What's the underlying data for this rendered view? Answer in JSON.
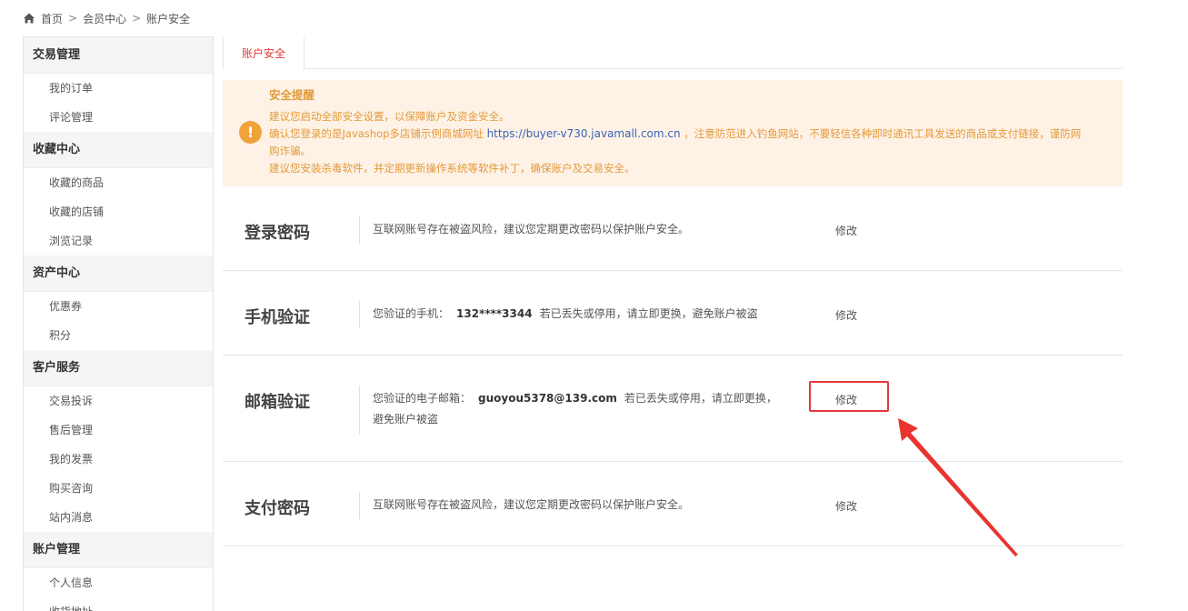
{
  "breadcrumb": {
    "home": "首页",
    "sep": ">",
    "member_center": "会员中心",
    "current": "账户安全"
  },
  "sidebar": {
    "groups": [
      {
        "title": "交易管理",
        "items": [
          "我的订单",
          "评论管理"
        ]
      },
      {
        "title": "收藏中心",
        "items": [
          "收藏的商品",
          "收藏的店铺",
          "浏览记录"
        ]
      },
      {
        "title": "资产中心",
        "items": [
          "优惠券",
          "积分"
        ]
      },
      {
        "title": "客户服务",
        "items": [
          "交易投诉",
          "售后管理",
          "我的发票",
          "购买咨询",
          "站内消息"
        ]
      },
      {
        "title": "账户管理",
        "items": [
          "个人信息",
          "收货地址"
        ]
      }
    ]
  },
  "tabs": {
    "active": "账户安全"
  },
  "notice": {
    "icon": "!",
    "title": "安全提醒",
    "line1": "建议您启动全部安全设置，以保障账户及资金安全。",
    "line2_prefix": "确认您登录的是Javashop多店铺示例商城网址",
    "line2_url": "https://buyer-v730.javamall.com.cn",
    "line2_suffix": "，注意防范进入钓鱼网站，不要轻信各种即时通讯工具发送的商品或支付链接，谨防网",
    "line2_cont": "购诈骗。",
    "line3": "建议您安装杀毒软件，并定期更新操作系统等软件补丁，确保账户及交易安全。"
  },
  "security": {
    "login": {
      "title": "登录密码",
      "desc": "互联网账号存在被盗风险，建议您定期更改密码以保护账户安全。",
      "action": "修改"
    },
    "mobile": {
      "title": "手机验证",
      "desc_prefix": "您验证的手机：",
      "value": "132****3344",
      "desc_suffix": "若已丢失或停用，请立即更换，避免账户被盗",
      "action": "修改"
    },
    "email": {
      "title": "邮箱验证",
      "desc_prefix": "您验证的电子邮箱：",
      "value": "guoyou5378@139.com",
      "desc_suffix": "若已丢失或停用，请立即更换，避免账户被盗",
      "action": "修改"
    },
    "pay": {
      "title": "支付密码",
      "desc": "互联网账号存在被盗风险，建议您定期更改密码以保护账户安全。",
      "action": "修改"
    }
  },
  "colors": {
    "accent": "#e4393c",
    "notice_bg": "#fef2e6",
    "notice_text": "#e39a3b",
    "link": "#3d62b6"
  },
  "icons": {
    "home": "home-icon",
    "warning": "warning-icon",
    "arrow": "red-arrow-annotation"
  }
}
